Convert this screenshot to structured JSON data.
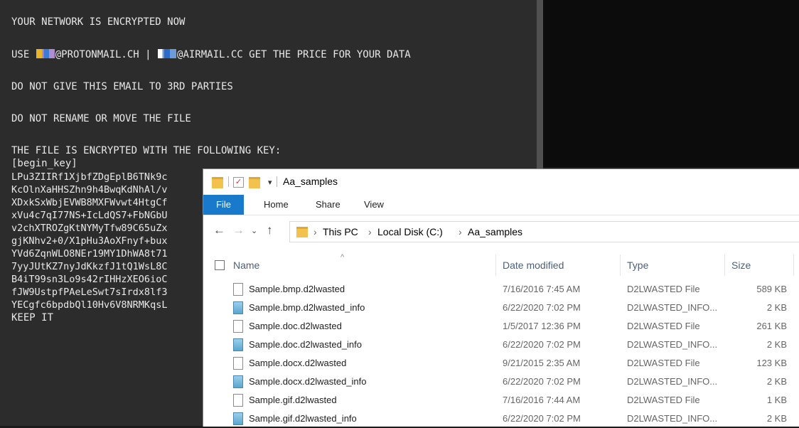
{
  "terminal": {
    "lines": [
      "YOUR NETWORK IS ENCRYPTED NOW",
      "DO NOT GIVE THIS EMAIL TO 3RD PARTIES",
      "DO NOT RENAME OR MOVE THE FILE",
      "THE FILE IS ENCRYPTED WITH THE FOLLOWING KEY:",
      "[begin_key]",
      "LPu3ZIIRf1XjbfZDgEplB6TNk9c",
      "KcOlnXaHHSZhn9h4BwqKdNhAl/v",
      "XDxkSxWbjEVWB8MXFWvwt4HtgCf",
      "xVu4c7qI77NS+IcLdQS7+FbNGbU",
      "v2chXTROZgKtNYMyTfw89C65uZx",
      "gjKNhv2+0/X1pHu3AoXFnyf+bux",
      "YVd6ZqnWLO8NEr19MY1DhWA8t71",
      "7yyJUtKZ7nyJdKkzfJ1tQ1WsL8C",
      "B4iT99sn3Lo9s42rIHHzXEO6ioC",
      "fJW9UstpfPAeLeSwt7sIrdx8lf3",
      "YECgfc6bpdbQl10Hv6V8NRMKqsL",
      "KEEP IT"
    ],
    "use_line": {
      "prefix": "USE ",
      "email1_suffix": "@PROTONMAIL.CH | ",
      "email2_suffix": "@AIRMAIL.CC GET THE PRICE FOR YOUR DATA"
    }
  },
  "explorer": {
    "title": "Aa_samples",
    "ribbon_tabs": [
      "File",
      "Home",
      "Share",
      "View"
    ],
    "breadcrumb": [
      "This PC",
      "Local Disk (C:)",
      "Aa_samples"
    ],
    "columns": [
      "Name",
      "Date modified",
      "Type",
      "Size"
    ],
    "files": [
      {
        "name": "Sample.bmp.d2lwasted",
        "date": "7/16/2016 7:45 AM",
        "type": "D2LWASTED File",
        "size": "589 KB",
        "icon": "file"
      },
      {
        "name": "Sample.bmp.d2lwasted_info",
        "date": "6/22/2020 7:02 PM",
        "type": "D2LWASTED_INFO...",
        "size": "2 KB",
        "icon": "info"
      },
      {
        "name": "Sample.doc.d2lwasted",
        "date": "1/5/2017 12:36 PM",
        "type": "D2LWASTED File",
        "size": "261 KB",
        "icon": "file"
      },
      {
        "name": "Sample.doc.d2lwasted_info",
        "date": "6/22/2020 7:02 PM",
        "type": "D2LWASTED_INFO...",
        "size": "2 KB",
        "icon": "info"
      },
      {
        "name": "Sample.docx.d2lwasted",
        "date": "9/21/2015 2:35 AM",
        "type": "D2LWASTED File",
        "size": "123 KB",
        "icon": "file"
      },
      {
        "name": "Sample.docx.d2lwasted_info",
        "date": "6/22/2020 7:02 PM",
        "type": "D2LWASTED_INFO...",
        "size": "2 KB",
        "icon": "info"
      },
      {
        "name": "Sample.gif.d2lwasted",
        "date": "7/16/2016 7:44 AM",
        "type": "D2LWASTED File",
        "size": "1 KB",
        "icon": "file"
      },
      {
        "name": "Sample.gif.d2lwasted_info",
        "date": "6/22/2020 7:02 PM",
        "type": "D2LWASTED_INFO...",
        "size": "2 KB",
        "icon": "info"
      }
    ]
  }
}
